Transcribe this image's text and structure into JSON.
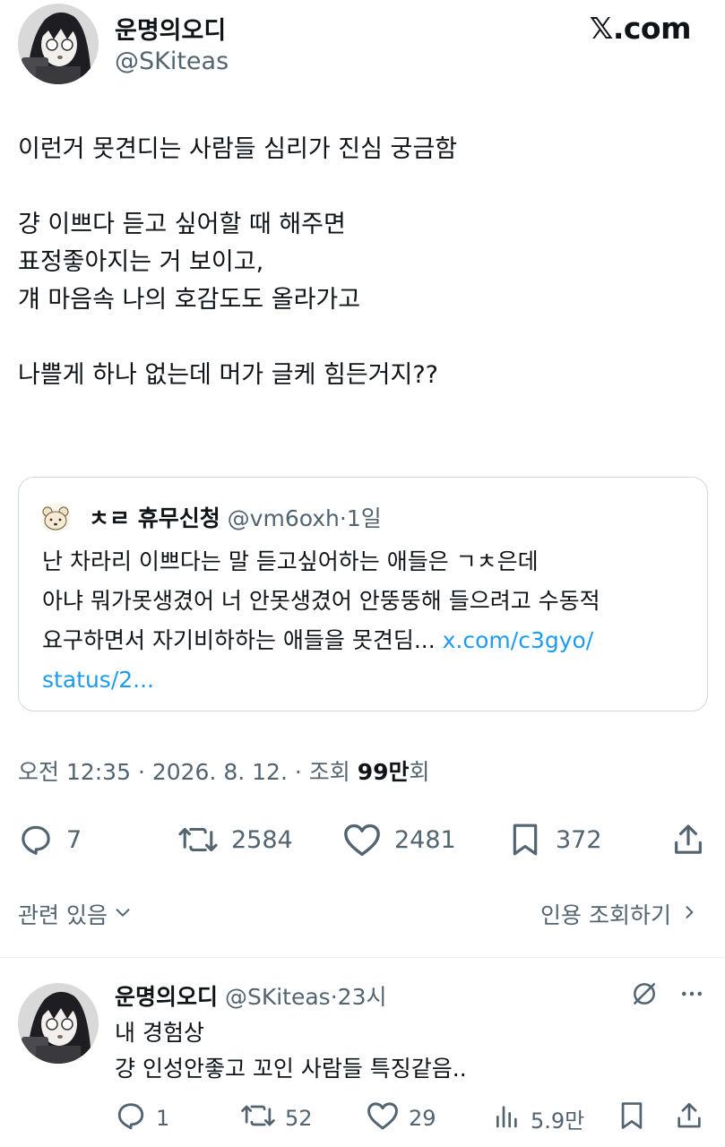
{
  "header": {
    "display_name": "운명의오디",
    "handle": "@SKiteas",
    "site": "𝕏.com"
  },
  "tweet": {
    "lines": [
      "이런거 못견디는 사람들 심리가 진심 궁금함",
      "",
      "걍 이쁘다 듣고 싶어할 때 해주면",
      "표정좋아지는 거 보이고,",
      "걔 마음속 나의 호감도도 올라가고",
      "",
      "나쁠게 하나 없는데 머가 글케 힘든거지??"
    ]
  },
  "quote": {
    "name": "ㅊㄹ 휴무신청",
    "handle": "@vm6oxh",
    "time": "·1일",
    "lines": [
      "난 차라리 이쁘다는 말 듣고싶어하는 애들은 ㄱㅊ은데",
      "아냐 뭐가못생겼어 너 안못생겼어 안뚱뚱해 들으려고 수동적",
      "요구하면서 자기비하하는 애들을 못견딤..."
    ],
    "link_part1": "x.com/c3gyo/",
    "link_part2": "status/2..."
  },
  "meta": {
    "prefix": "오전 12:35 · 2026. 8. 12. · 조회 ",
    "views": "99만",
    "suffix": "회"
  },
  "actions": {
    "replies": "7",
    "retweets": "2584",
    "likes": "2481",
    "bookmarks": "372"
  },
  "related": {
    "label": "관련 있음",
    "quotes_link": "인용 조회하기"
  },
  "reply": {
    "name": "운명의오디",
    "handle": "@SKiteas",
    "time": "·23시",
    "lines": [
      "내 경험상",
      "걍 인성안좋고 꼬인 사람들 특징같음.."
    ],
    "replies": "1",
    "retweets": "52",
    "likes": "29",
    "views": "5.9만"
  },
  "colors": {
    "text": "#0f1419",
    "secondary": "#536471",
    "link": "#1d9bf0",
    "border": "#cfd9de"
  }
}
